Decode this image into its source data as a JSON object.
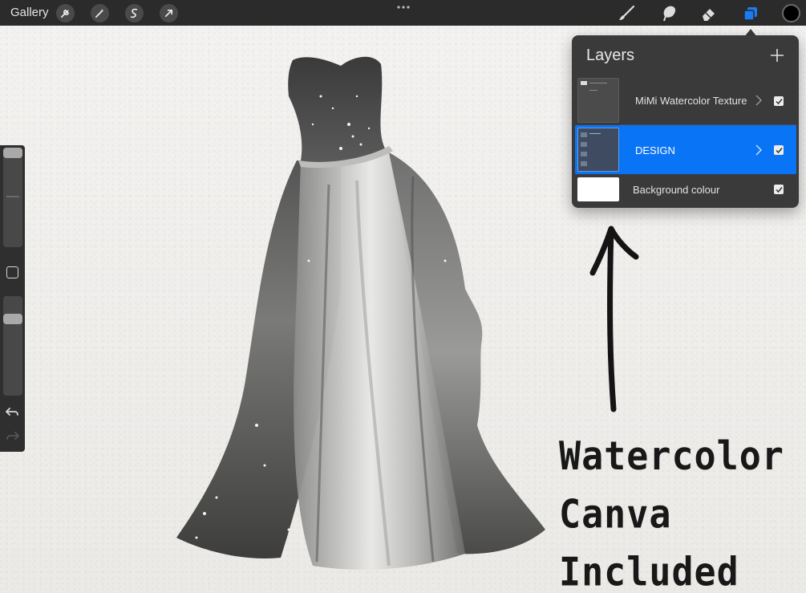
{
  "toolbar": {
    "gallery_label": "Gallery",
    "left_tools": [
      "wrench-icon",
      "magic-wand-icon",
      "selection-icon",
      "transform-arrow-icon"
    ],
    "right_tools": [
      "brush-icon",
      "smudge-icon",
      "eraser-icon",
      "layers-icon"
    ],
    "active_tool": "layers-icon",
    "current_color": "#000000",
    "accent_color": "#1a7bf2"
  },
  "layers_panel": {
    "title": "Layers",
    "add_icon": "plus-icon",
    "layers": [
      {
        "name": "MiMi Watercolor Texture",
        "is_group": true,
        "visible": true,
        "selected": false
      },
      {
        "name": "DESIGN",
        "is_group": true,
        "visible": true,
        "selected": true
      },
      {
        "name": "Background colour",
        "is_group": false,
        "visible": true,
        "selected": false
      }
    ]
  },
  "sidebar": {
    "brush_size_level": 0.0,
    "opacity_level": 0.05,
    "modify_icon": "square-icon",
    "undo_icon": "undo-icon",
    "redo_icon": "redo-icon"
  },
  "promo_text": [
    "Watercolor",
    "Canva",
    "Included"
  ]
}
